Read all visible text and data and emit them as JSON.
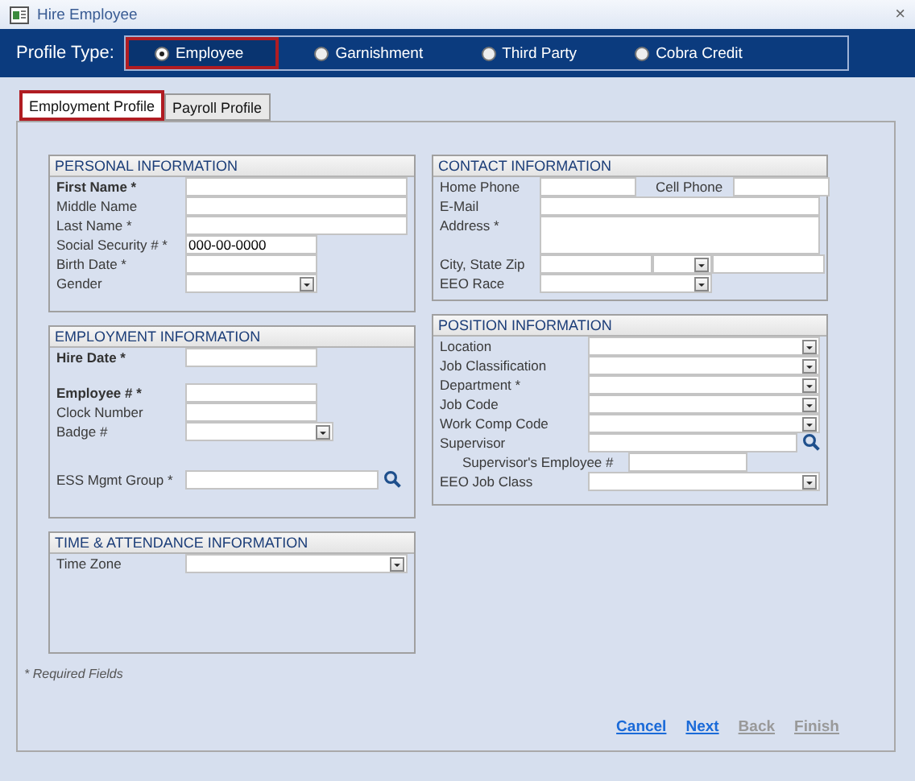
{
  "window": {
    "title": "Hire Employee",
    "close": "×"
  },
  "profile_type": {
    "label": "Profile Type:",
    "options": [
      {
        "label": "Employee",
        "selected": true,
        "highlighted": true
      },
      {
        "label": "Garnishment",
        "selected": false,
        "highlighted": false
      },
      {
        "label": "Third Party",
        "selected": false,
        "highlighted": false
      },
      {
        "label": "Cobra Credit",
        "selected": false,
        "highlighted": false
      }
    ]
  },
  "tabs": [
    {
      "label": "Employment Profile",
      "selected": true,
      "highlighted": true
    },
    {
      "label": "Payroll Profile",
      "selected": false,
      "highlighted": false
    }
  ],
  "columns": [
    {
      "sections": [
        {
          "title": "PERSONAL INFORMATION",
          "rows": [
            {
              "label": "First Name *",
              "bold": true,
              "fields": [
                {
                  "kind": "text"
                }
              ]
            },
            {
              "label": "Middle Name",
              "bold": false,
              "fields": [
                {
                  "kind": "text"
                }
              ]
            },
            {
              "label": "Last Name *",
              "bold": false,
              "fields": [
                {
                  "kind": "text"
                }
              ]
            },
            {
              "label": "Social Security # *",
              "bold": false,
              "fields": [
                {
                  "kind": "text",
                  "value": "000-00-0000"
                }
              ]
            },
            {
              "label": "Birth Date *",
              "bold": false,
              "fields": [
                {
                  "kind": "text"
                }
              ]
            },
            {
              "label": "Gender",
              "bold": false,
              "fields": [
                {
                  "kind": "dropdown"
                }
              ]
            }
          ]
        },
        {
          "title": "EMPLOYMENT INFORMATION",
          "rows": [
            {
              "label": "Hire Date *",
              "bold": true,
              "fields": [
                {
                  "kind": "text"
                }
              ]
            },
            {
              "label": "Employee # *",
              "bold": true,
              "fields": [
                {
                  "kind": "text"
                }
              ]
            },
            {
              "label": "Clock Number",
              "bold": false,
              "fields": [
                {
                  "kind": "text"
                }
              ]
            },
            {
              "label": "Badge #",
              "bold": false,
              "fields": [
                {
                  "kind": "dropdown"
                }
              ]
            },
            {
              "label": "ESS Mgmt Group *",
              "bold": false,
              "fields": [
                {
                  "kind": "text"
                },
                {
                  "kind": "search"
                }
              ]
            }
          ]
        },
        {
          "title": "TIME & ATTENDANCE INFORMATION",
          "rows": [
            {
              "label": "Time Zone",
              "bold": false,
              "fields": [
                {
                  "kind": "dropdown"
                }
              ]
            }
          ]
        }
      ]
    },
    {
      "sections": [
        {
          "title": "CONTACT INFORMATION",
          "rows": [
            {
              "label": "Home Phone",
              "bold": false,
              "fields": [
                {
                  "kind": "text"
                },
                {
                  "kind": "label",
                  "text": "Cell Phone"
                },
                {
                  "kind": "text"
                }
              ]
            },
            {
              "label": "E-Mail",
              "bold": false,
              "fields": [
                {
                  "kind": "text"
                }
              ]
            },
            {
              "label": "Address *",
              "bold": false,
              "fields": [
                {
                  "kind": "textarea"
                }
              ]
            },
            {
              "label": "City, State Zip",
              "bold": false,
              "fields": [
                {
                  "kind": "text"
                },
                {
                  "kind": "dropdown"
                },
                {
                  "kind": "text"
                }
              ]
            },
            {
              "label": "EEO Race",
              "bold": false,
              "fields": [
                {
                  "kind": "dropdown"
                }
              ]
            }
          ]
        },
        {
          "title": "POSITION INFORMATION",
          "rows": [
            {
              "label": "Location",
              "bold": false,
              "fields": [
                {
                  "kind": "dropdown"
                }
              ]
            },
            {
              "label": "Job Classification",
              "bold": false,
              "fields": [
                {
                  "kind": "dropdown"
                }
              ]
            },
            {
              "label": "Department *",
              "bold": false,
              "fields": [
                {
                  "kind": "dropdown"
                }
              ]
            },
            {
              "label": "Job Code",
              "bold": false,
              "fields": [
                {
                  "kind": "dropdown"
                }
              ]
            },
            {
              "label": "Work Comp Code",
              "bold": false,
              "fields": [
                {
                  "kind": "dropdown"
                }
              ]
            },
            {
              "label": "Supervisor",
              "bold": false,
              "fields": [
                {
                  "kind": "text"
                },
                {
                  "kind": "search"
                }
              ],
              "children": [
                {
                  "label": "Supervisor's Employee #",
                  "bold": false,
                  "fields": [
                    {
                      "kind": "text"
                    }
                  ]
                }
              ]
            },
            {
              "label": "EEO Job Class",
              "bold": false,
              "fields": [
                {
                  "kind": "dropdown"
                }
              ]
            }
          ]
        }
      ]
    }
  ],
  "required_note": "* Required Fields",
  "footer_links": [
    {
      "label": "Cancel",
      "disabled": false
    },
    {
      "label": "Next",
      "disabled": false
    },
    {
      "label": "Back",
      "disabled": true
    },
    {
      "label": "Finish",
      "disabled": true
    }
  ]
}
